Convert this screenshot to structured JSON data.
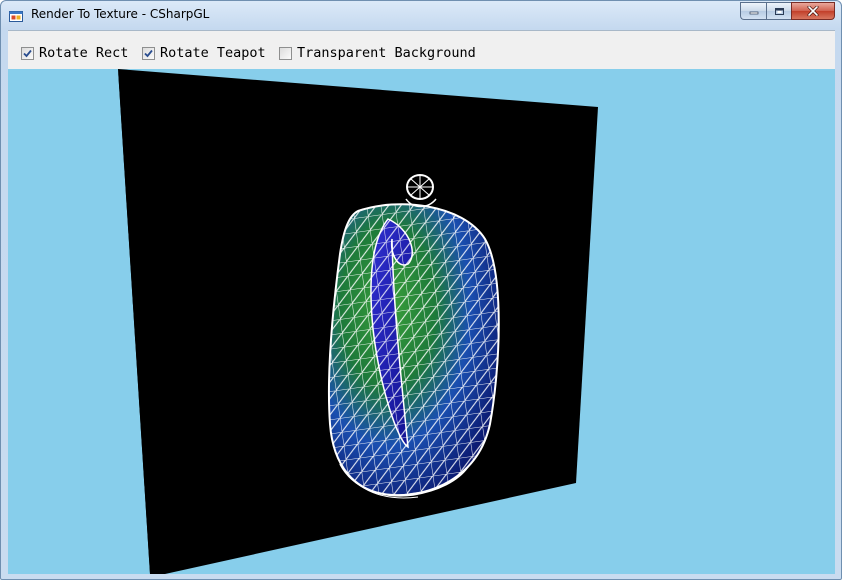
{
  "window": {
    "title": "Render To Texture - CSharpGL",
    "icon": "app-window-icon",
    "buttons": [
      "minimize-icon",
      "maximize-icon",
      "close-icon"
    ]
  },
  "options": [
    {
      "label": "Rotate Rect",
      "checked": true
    },
    {
      "label": "Rotate Teapot",
      "checked": true
    },
    {
      "label": "Transparent Background",
      "checked": false
    }
  ],
  "scene": {
    "background_color": "#87ceeb",
    "quad_color": "#000000",
    "teapot_colors": [
      "#1f8a1f",
      "#1a4fb0",
      "#0a0a7a"
    ],
    "wireframe_color": "#ffffff"
  }
}
